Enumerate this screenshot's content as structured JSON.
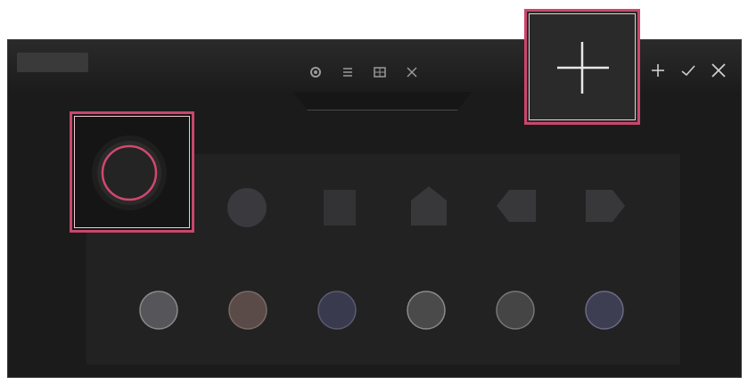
{
  "toolbar": {
    "icons": [
      "gear-icon",
      "sliders-icon",
      "grid-icon",
      "close-icon"
    ]
  },
  "window_controls": {
    "icons": [
      "add-icon",
      "check-icon",
      "close-icon"
    ]
  },
  "add_button": {
    "icon": "plus-icon"
  },
  "shapes": {
    "row1": [
      "circle",
      "square",
      "pentagon",
      "arrow-left",
      "arrow-right"
    ],
    "row2_colors": [
      "#55555a",
      "#5a4a48",
      "#3a3a4e",
      "#4a4a4a",
      "#454545",
      "#3e3e52"
    ]
  },
  "colors": {
    "accent": "#c8476c",
    "selected_ring": "#d0496f",
    "background": "#1b1b1b",
    "panel": "#222222"
  }
}
